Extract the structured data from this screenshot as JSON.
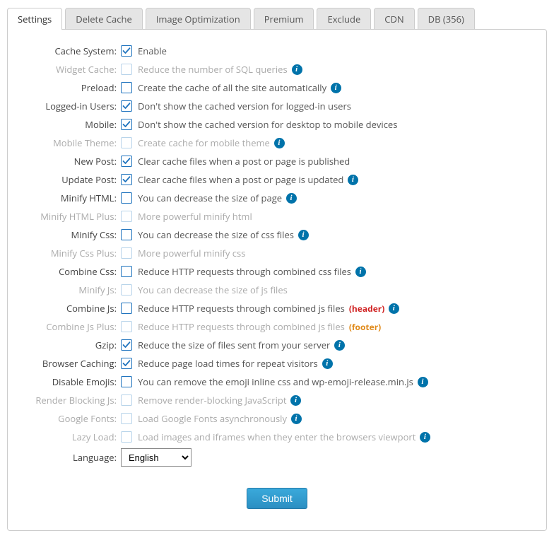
{
  "tabs": [
    "Settings",
    "Delete Cache",
    "Image Optimization",
    "Premium",
    "Exclude",
    "CDN",
    "DB (356)"
  ],
  "activeTab": 0,
  "rows": [
    {
      "label": "Cache System:",
      "dim": false,
      "checked": true,
      "cbdim": false,
      "desc": "Enable",
      "info": false
    },
    {
      "label": "Widget Cache:",
      "dim": true,
      "checked": false,
      "cbdim": true,
      "desc": "Reduce the number of SQL queries",
      "info": true,
      "descdim": true
    },
    {
      "label": "Preload:",
      "dim": false,
      "checked": false,
      "cbdim": false,
      "desc": "Create the cache of all the site automatically",
      "info": true
    },
    {
      "label": "Logged-in Users:",
      "dim": false,
      "checked": true,
      "cbdim": false,
      "desc": "Don't show the cached version for logged-in users",
      "info": false
    },
    {
      "label": "Mobile:",
      "dim": false,
      "checked": true,
      "cbdim": false,
      "desc": "Don't show the cached version for desktop to mobile devices",
      "info": false
    },
    {
      "label": "Mobile Theme:",
      "dim": true,
      "checked": false,
      "cbdim": true,
      "desc": "Create cache for mobile theme",
      "info": true,
      "descdim": true
    },
    {
      "label": "New Post:",
      "dim": false,
      "checked": true,
      "cbdim": false,
      "desc": "Clear cache files when a post or page is published",
      "info": false
    },
    {
      "label": "Update Post:",
      "dim": false,
      "checked": true,
      "cbdim": false,
      "desc": "Clear cache files when a post or page is updated",
      "info": true
    },
    {
      "label": "Minify HTML:",
      "dim": false,
      "checked": false,
      "cbdim": false,
      "desc": "You can decrease the size of page",
      "info": true
    },
    {
      "label": "Minify HTML Plus:",
      "dim": true,
      "checked": false,
      "cbdim": true,
      "desc": "More powerful minify html",
      "info": false,
      "descdim": true
    },
    {
      "label": "Minify Css:",
      "dim": false,
      "checked": false,
      "cbdim": false,
      "desc": "You can decrease the size of css files",
      "info": true
    },
    {
      "label": "Minify Css Plus:",
      "dim": true,
      "checked": false,
      "cbdim": true,
      "desc": "More powerful minify css",
      "info": false,
      "descdim": true
    },
    {
      "label": "Combine Css:",
      "dim": false,
      "checked": false,
      "cbdim": false,
      "desc": "Reduce HTTP requests through combined css files",
      "info": true
    },
    {
      "label": "Minify Js:",
      "dim": true,
      "checked": false,
      "cbdim": true,
      "desc": "You can decrease the size of js files",
      "info": false,
      "descdim": true
    },
    {
      "label": "Combine Js:",
      "dim": false,
      "checked": false,
      "cbdim": false,
      "desc": "Reduce HTTP requests through combined js files",
      "info": true,
      "tag": "header"
    },
    {
      "label": "Combine Js Plus:",
      "dim": true,
      "checked": false,
      "cbdim": true,
      "desc": "Reduce HTTP requests through combined js files",
      "info": false,
      "descdim": true,
      "tag": "footer"
    },
    {
      "label": "Gzip:",
      "dim": false,
      "checked": true,
      "cbdim": false,
      "desc": "Reduce the size of files sent from your server",
      "info": true
    },
    {
      "label": "Browser Caching:",
      "dim": false,
      "checked": true,
      "cbdim": false,
      "desc": "Reduce page load times for repeat visitors",
      "info": true
    },
    {
      "label": "Disable Emojis:",
      "dim": false,
      "checked": false,
      "cbdim": false,
      "desc": "You can remove the emoji inline css and wp-emoji-release.min.js",
      "info": true
    },
    {
      "label": "Render Blocking Js:",
      "dim": true,
      "checked": false,
      "cbdim": true,
      "desc": "Remove render-blocking JavaScript",
      "info": true,
      "descdim": true
    },
    {
      "label": "Google Fonts:",
      "dim": true,
      "checked": false,
      "cbdim": true,
      "desc": "Load Google Fonts asynchronously",
      "info": true,
      "descdim": true
    },
    {
      "label": "Lazy Load:",
      "dim": true,
      "checked": false,
      "cbdim": true,
      "desc": "Load images and iframes when they enter the browsers viewport",
      "info": true,
      "descdim": true
    }
  ],
  "language": {
    "label": "Language:",
    "value": "English"
  },
  "submit": "Submit"
}
